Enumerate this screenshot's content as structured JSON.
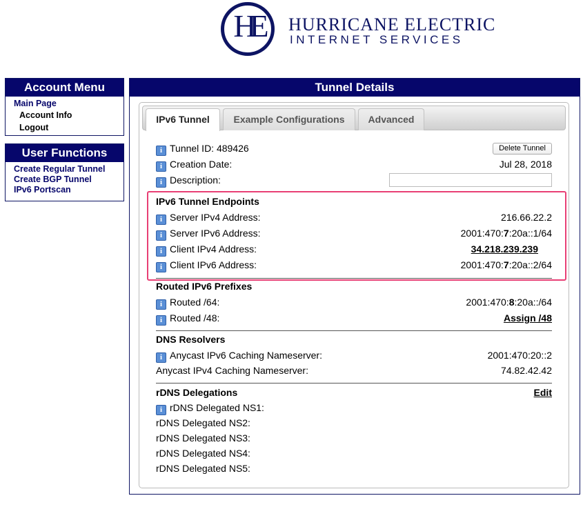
{
  "logo": {
    "monogram": "HE",
    "line1": "HURRICANE ELECTRIC",
    "line2": "INTERNET SERVICES"
  },
  "account_menu": {
    "title": "Account Menu",
    "items": [
      {
        "label": "Main Page"
      },
      {
        "label": "Account Info"
      },
      {
        "label": "Logout"
      }
    ]
  },
  "user_functions": {
    "title": "User Functions",
    "items": [
      {
        "label": "Create Regular Tunnel"
      },
      {
        "label": "Create BGP Tunnel"
      },
      {
        "label": "IPv6 Portscan"
      }
    ]
  },
  "main": {
    "title": "Tunnel Details",
    "tabs": [
      {
        "label": "IPv6 Tunnel",
        "active": true
      },
      {
        "label": "Example Configurations",
        "active": false
      },
      {
        "label": "Advanced",
        "active": false
      }
    ],
    "tunnel_id_label": "Tunnel ID: 489426",
    "delete_button": "Delete Tunnel",
    "creation_date_label": "Creation Date:",
    "creation_date_value": "Jul 28, 2018",
    "description_label": "Description:",
    "description_value": "",
    "endpoints": {
      "title": "IPv6 Tunnel Endpoints",
      "server_ipv4_label": "Server IPv4 Address:",
      "server_ipv4_value": "216.66.22.2",
      "server_ipv6_label": "Server IPv6 Address:",
      "server_ipv6_pre": "2001:470:",
      "server_ipv6_bold": "7",
      "server_ipv6_post": ":20a::1/64",
      "client_ipv4_label": "Client IPv4 Address:",
      "client_ipv4_value": "34.218.239.239",
      "client_ipv6_label": "Client IPv6 Address:",
      "client_ipv6_pre": "2001:470:",
      "client_ipv6_bold": "7",
      "client_ipv6_post": ":20a::2/64"
    },
    "routed": {
      "title": "Routed IPv6 Prefixes",
      "r64_label": "Routed /64:",
      "r64_pre": "2001:470:",
      "r64_bold": "8",
      "r64_post": ":20a::/64",
      "r48_label": "Routed /48:",
      "r48_link": "Assign /48"
    },
    "dns": {
      "title": "DNS Resolvers",
      "ipv6_label": "Anycast IPv6 Caching Nameserver:",
      "ipv6_value": "2001:470:20::2",
      "ipv4_label": "Anycast IPv4 Caching Nameserver:",
      "ipv4_value": "74.82.42.42"
    },
    "rdns": {
      "title": "rDNS Delegations",
      "edit_link": "Edit",
      "ns1": "rDNS Delegated NS1:",
      "ns2": "rDNS Delegated NS2:",
      "ns3": "rDNS Delegated NS3:",
      "ns4": "rDNS Delegated NS4:",
      "ns5": "rDNS Delegated NS5:"
    }
  }
}
